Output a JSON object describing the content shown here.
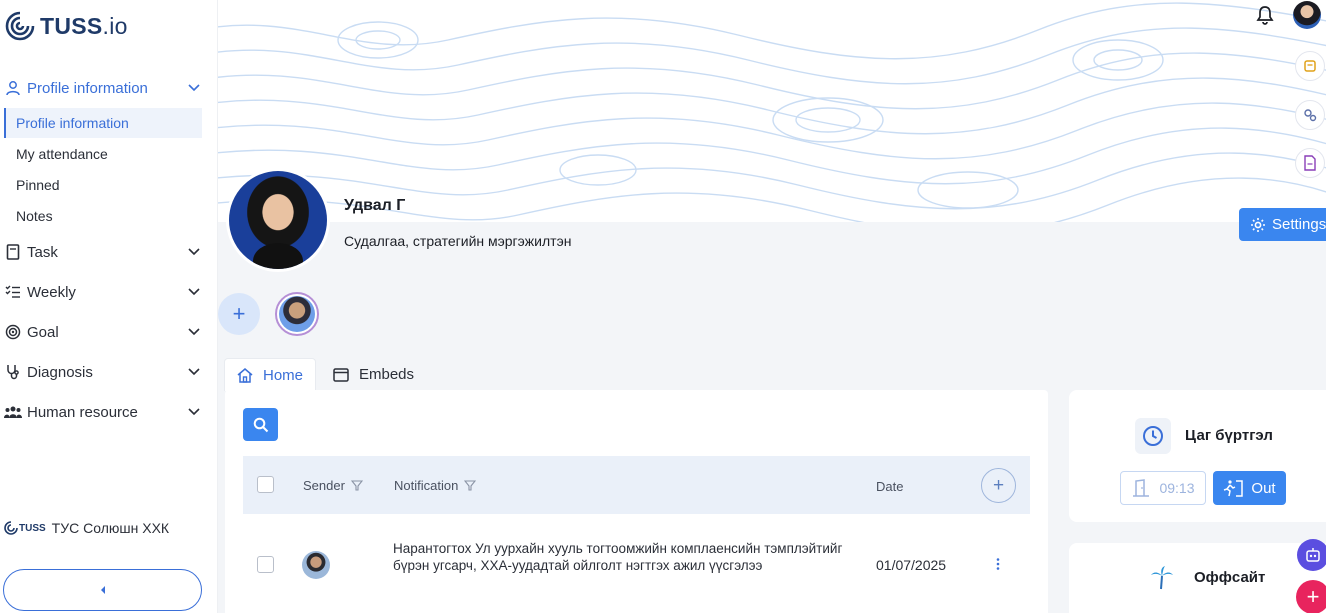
{
  "brand": {
    "logo_text": "TUSS",
    "logo_suffix": ".io"
  },
  "sidebar": {
    "groups": [
      {
        "label": "Profile information",
        "icon": "user-icon",
        "expanded": true
      },
      {
        "label": "Task",
        "icon": "book-icon"
      },
      {
        "label": "Weekly",
        "icon": "checklist-icon"
      },
      {
        "label": "Goal",
        "icon": "target-icon"
      },
      {
        "label": "Diagnosis",
        "icon": "stethoscope-icon"
      },
      {
        "label": "Human resource",
        "icon": "people-icon"
      }
    ],
    "sub_items": [
      "Profile information",
      "My attendance",
      "Pinned",
      "Notes"
    ],
    "company_logo_text": "TUSS",
    "company": "ТУС Солюшн ХХК"
  },
  "profile": {
    "name": "Удвал Г",
    "role": "Судалгаа, стратегийн мэргэжилтэн",
    "settings_label": "Settings"
  },
  "tabs": [
    {
      "label": "Home",
      "icon": "home-icon",
      "active": true
    },
    {
      "label": "Embeds",
      "icon": "window-icon"
    }
  ],
  "table": {
    "headers": {
      "sender": "Sender",
      "notification": "Notification",
      "date": "Date"
    },
    "rows": [
      {
        "notification": "Нарантогтох Ул уурхайн хууль тогтоомжийн комплаенсийн тэмплэйтийг бүрэн угсарч, ХХА-уудадтай ойлголт нэгтгэх ажил үүсгэлээ",
        "date": "01/07/2025"
      }
    ]
  },
  "time_card": {
    "title": "Цаг бүртгэл",
    "in_time": "09:13",
    "out_label": "Out"
  },
  "offsite_card": {
    "title": "Оффсайт"
  },
  "colors": {
    "accent": "#3a86ef",
    "fab_pink": "#e8245e",
    "fab_purple": "#5b4ee0"
  }
}
